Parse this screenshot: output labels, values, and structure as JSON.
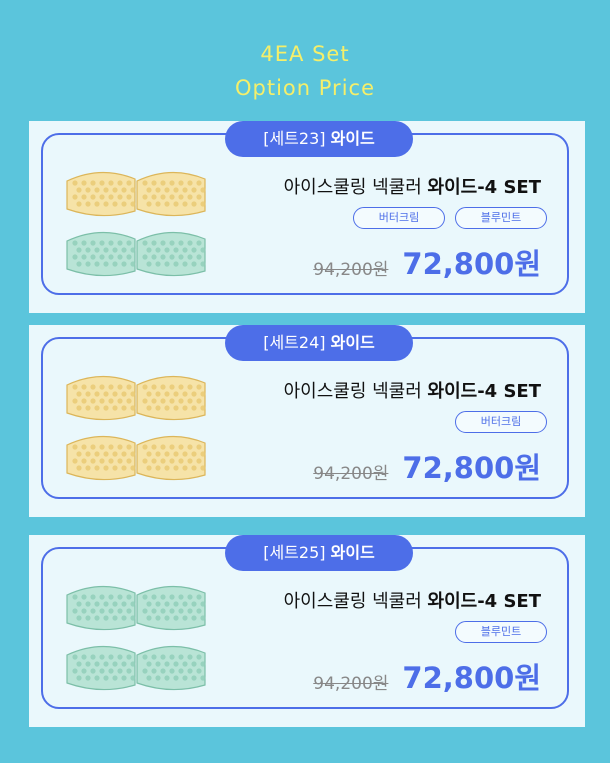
{
  "header": {
    "line1": "4EA Set",
    "line2": "Option Price"
  },
  "cards": [
    {
      "set_label": "[세트23]",
      "set_type": "와이드",
      "product_name": "아이스쿨링 넥쿨러",
      "product_suffix": "와이드-4 SET",
      "options": [
        "버터크림",
        "블루민트"
      ],
      "original_price": "94,200원",
      "sale_price": "72,800원",
      "image_colors": [
        "yellow",
        "yellow",
        "mint",
        "mint"
      ]
    },
    {
      "set_label": "[세트24]",
      "set_type": "와이드",
      "product_name": "아이스쿨링 넥쿨러",
      "product_suffix": "와이드-4 SET",
      "options": [
        "버터크림"
      ],
      "original_price": "94,200원",
      "sale_price": "72,800원",
      "image_colors": [
        "yellow",
        "yellow",
        "yellow",
        "yellow"
      ]
    },
    {
      "set_label": "[세트25]",
      "set_type": "와이드",
      "product_name": "아이스쿨링 넥쿨러",
      "product_suffix": "와이드-4 SET",
      "options": [
        "블루민트"
      ],
      "original_price": "94,200원",
      "sale_price": "72,800원",
      "image_colors": [
        "mint",
        "mint",
        "mint",
        "mint"
      ]
    }
  ],
  "colors": {
    "background": "#5bc5dc",
    "header_text": "#f5ef6a",
    "accent": "#4d6ee8",
    "card_bg": "#eaf8fc",
    "yellow_fill": "#f6e3a8",
    "mint_fill": "#b9e4d6"
  }
}
